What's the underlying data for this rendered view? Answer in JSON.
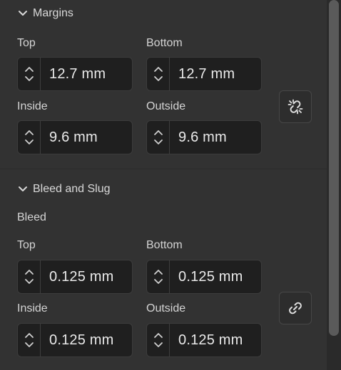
{
  "margins": {
    "header": "Margins",
    "top_label": "Top",
    "top_value": "12.7 mm",
    "bottom_label": "Bottom",
    "bottom_value": "12.7 mm",
    "inside_label": "Inside",
    "inside_value": "9.6 mm",
    "outside_label": "Outside",
    "outside_value": "9.6 mm",
    "link_icon": "unlink-icon"
  },
  "bleed_slug": {
    "header": "Bleed and Slug",
    "bleed_label": "Bleed",
    "top_label": "Top",
    "top_value": "0.125 mm",
    "bottom_label": "Bottom",
    "bottom_value": "0.125 mm",
    "inside_label": "Inside",
    "inside_value": "0.125 mm",
    "outside_label": "Outside",
    "outside_value": "0.125 mm",
    "link_icon": "link-icon"
  }
}
